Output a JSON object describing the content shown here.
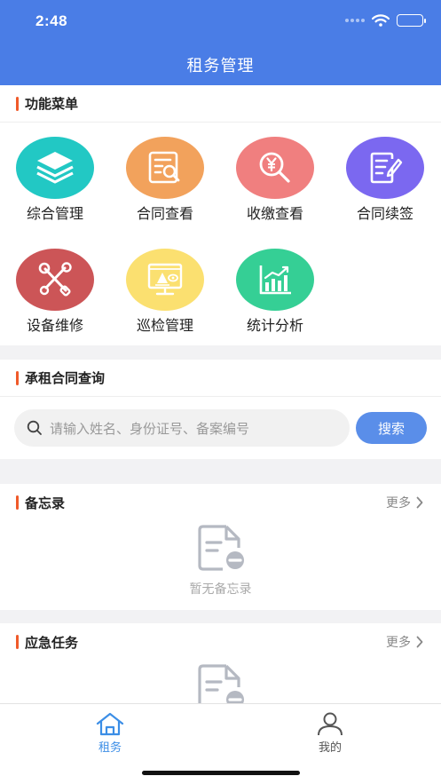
{
  "status_bar": {
    "time": "2:48"
  },
  "header": {
    "title": "租务管理"
  },
  "menu_section": {
    "title": "功能菜单",
    "items": [
      {
        "label": "综合管理",
        "color": "#22c8c4",
        "icon": "layers-icon"
      },
      {
        "label": "合同查看",
        "color": "#f2a25c",
        "icon": "contract-search-icon"
      },
      {
        "label": "收缴查看",
        "color": "#f07f7f",
        "icon": "yen-search-icon"
      },
      {
        "label": "合同续签",
        "color": "#7b68f0",
        "icon": "document-edit-icon"
      },
      {
        "label": "设备维修",
        "color": "#cc5557",
        "icon": "wrench-screwdriver-icon"
      },
      {
        "label": "巡检管理",
        "color": "#fbe070",
        "icon": "monitor-inspect-icon"
      },
      {
        "label": "统计分析",
        "color": "#35cf95",
        "icon": "bar-chart-icon"
      }
    ]
  },
  "contract_query": {
    "title": "承租合同查询",
    "placeholder": "请输入姓名、身份证号、备案编号",
    "search_label": "搜索"
  },
  "memo": {
    "title": "备忘录",
    "more_label": "更多",
    "empty_text": "暂无备忘录"
  },
  "emergency": {
    "title": "应急任务",
    "more_label": "更多"
  },
  "tabbar": {
    "items": [
      {
        "label": "租务",
        "active": true,
        "color": "#3c8ee6"
      },
      {
        "label": "我的",
        "active": false,
        "color": "#555555"
      }
    ]
  }
}
